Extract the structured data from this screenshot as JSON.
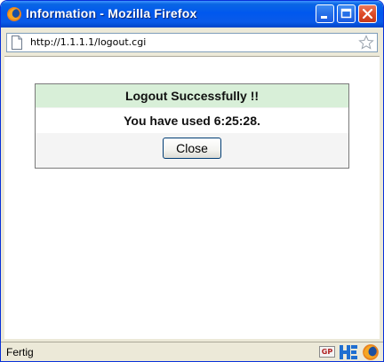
{
  "window": {
    "title": "Information - Mozilla Firefox",
    "icons": {
      "app": "firefox-icon",
      "minimize": "minimize-icon",
      "maximize": "maximize-icon",
      "close": "close-icon"
    }
  },
  "address_bar": {
    "url": "http://1.1.1.1/logout.cgi",
    "page_icon": "page-icon",
    "bookmark_icon": "star-icon"
  },
  "message": {
    "heading": "Logout Successfully !!",
    "usage_text": "You have used 6:25:28.",
    "close_button_label": "Close"
  },
  "status_bar": {
    "text": "Fertig",
    "gp_badge": "GP",
    "icons": [
      "gp-icon",
      "he-icon",
      "firefox-icon"
    ]
  },
  "colors": {
    "titlebar_blue": "#0058ee",
    "heading_bg": "#d8efd8",
    "close_red": "#df4b27"
  }
}
